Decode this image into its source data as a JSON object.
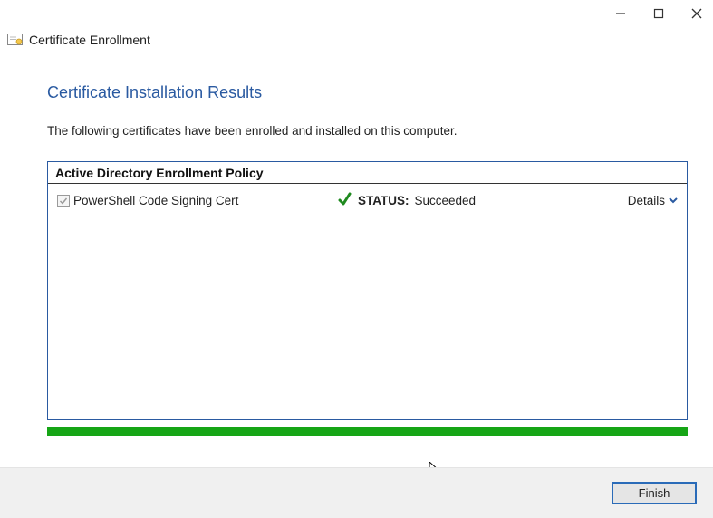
{
  "window": {
    "title": "Certificate Enrollment"
  },
  "page": {
    "heading": "Certificate Installation Results",
    "subtext": "The following certificates have been enrolled and installed on this computer."
  },
  "policy": {
    "title": "Active Directory Enrollment Policy",
    "items": [
      {
        "name": "PowerShell Code Signing Cert",
        "status_label": "STATUS:",
        "status_value": "Succeeded",
        "details_label": "Details"
      }
    ]
  },
  "footer": {
    "finish_label": "Finish"
  }
}
